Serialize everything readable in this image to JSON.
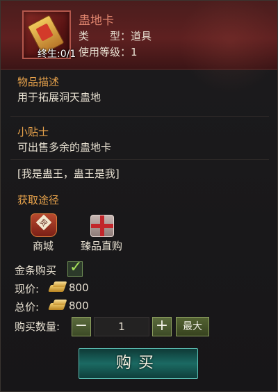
{
  "item": {
    "name": "蛊地卡",
    "type_key": "类　　型：",
    "type_value": "道具",
    "level_key": "使用等级：",
    "level_value": "1",
    "bind_label": "终生:0/1",
    "icon": "card-scroll-icon"
  },
  "description": {
    "title": "物品描述",
    "text": "用于拓展洞天蛊地"
  },
  "tips": {
    "title": "小贴士",
    "text": "可出售多余的蛊地卡"
  },
  "flavor_text": "[我是蛊王，蛊王是我]",
  "acquire": {
    "title": "获取途径",
    "sources": [
      {
        "label": "商城",
        "icon": "shop-icon"
      },
      {
        "label": "臻品直购",
        "icon": "gift-box-icon"
      }
    ]
  },
  "purchase": {
    "gold_bar_label": "金条购买",
    "gold_bar_checked": true,
    "current_price_label": "现价:",
    "current_price": "800",
    "total_price_label": "总价:",
    "total_price": "800",
    "quantity_label": "购买数量:",
    "quantity": "1",
    "minus": "−",
    "plus": "+",
    "max_label": "最大",
    "buy_label": "购买"
  },
  "colors": {
    "header_bg": "#5e2020",
    "item_name": "#e2866f",
    "section_title": "#e7a24b",
    "buy_button": "#1b6a63"
  }
}
